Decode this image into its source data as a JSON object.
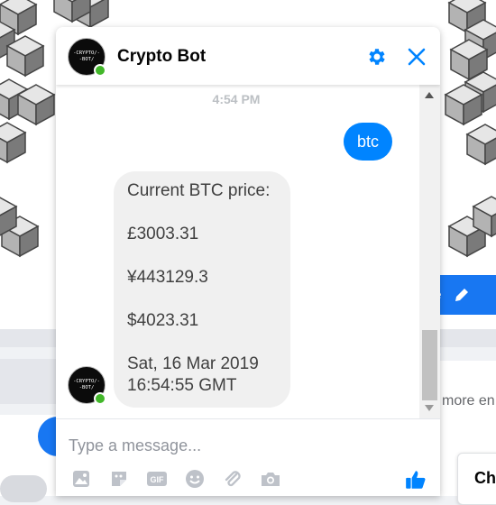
{
  "chat": {
    "title": "Crypto Bot",
    "avatar_text_line1": "-CRYPTO/-",
    "avatar_text_line2": "-BOT/",
    "timestamp": "4:54 PM",
    "messages": [
      {
        "from": "me",
        "text": "btc"
      },
      {
        "from": "bot",
        "lines": [
          "Current BTC price:",
          "£3003.31",
          "¥443129.3",
          "$4023.31",
          "Sat, 16 Mar 2019 16:54:55 GMT"
        ]
      }
    ],
    "input_placeholder": "Type a message...",
    "input_value": ""
  },
  "background": {
    "partial_edit_text": "e",
    "more_text": "more en",
    "card_text": "Ch"
  },
  "icons": {
    "header": [
      "gear-icon",
      "close-icon"
    ],
    "toolbar": [
      "photo-icon",
      "sticker-icon",
      "gif-icon",
      "emoji-icon",
      "attachment-icon",
      "camera-icon",
      "like-icon"
    ]
  },
  "colors": {
    "accent": "#0084ff",
    "outgoing_bubble": "#0084ff",
    "incoming_bubble": "#f0f0f0",
    "online": "#42b72a",
    "toolbar_icons": "#bec2c9"
  }
}
